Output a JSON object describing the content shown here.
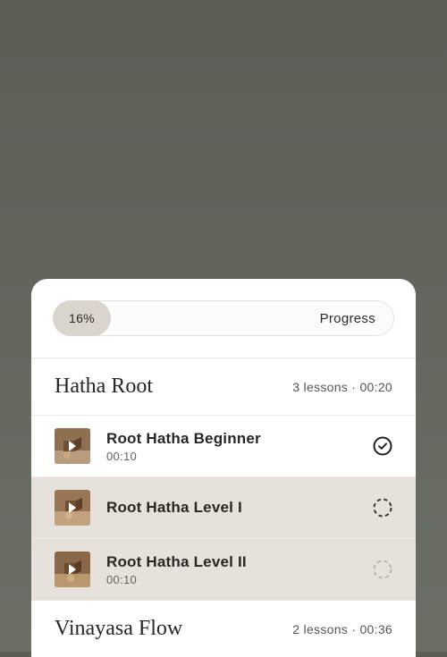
{
  "colors": {
    "accent": "#2e2a26",
    "muted": "#5a564f",
    "pill_bg": "#d9d4ce",
    "lesson_shade": "#e7e1db"
  },
  "progress": {
    "percent_label": "16%",
    "label": "Progress"
  },
  "sections": [
    {
      "title": "Hatha Root",
      "meta": "3 lessons · 00:20",
      "lessons": [
        {
          "title": "Root Hatha Beginner",
          "time": "00:10",
          "status": "complete"
        },
        {
          "title": "Root Hatha Level I",
          "time": "",
          "status": "current"
        },
        {
          "title": "Root Hatha Level II",
          "time": "00:10",
          "status": "todo"
        }
      ]
    },
    {
      "title": "Vinayasa Flow",
      "meta": "2 lessons · 00:36",
      "lessons": []
    }
  ]
}
